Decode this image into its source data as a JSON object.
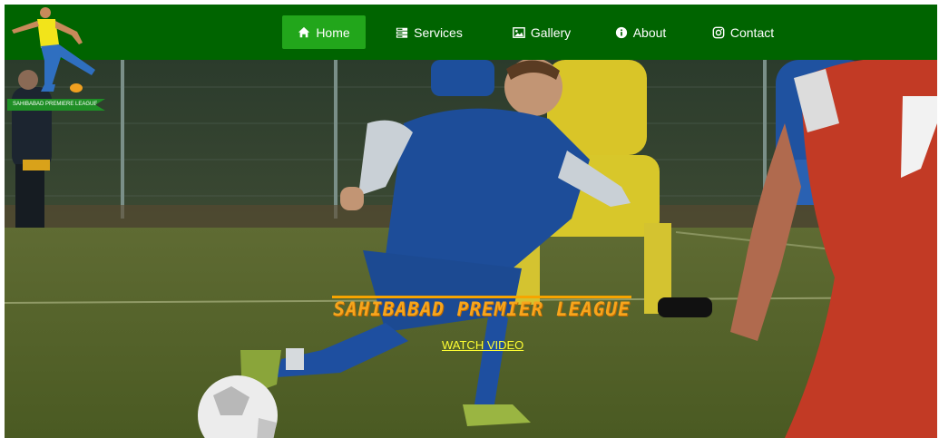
{
  "nav": {
    "items": [
      {
        "label": "Home",
        "icon": "home-icon",
        "active": true
      },
      {
        "label": "Services",
        "icon": "server-icon",
        "active": false
      },
      {
        "label": "Gallery",
        "icon": "image-icon",
        "active": false
      },
      {
        "label": "About",
        "icon": "info-icon",
        "active": false
      },
      {
        "label": "Contact",
        "icon": "instagram-icon",
        "active": false
      }
    ]
  },
  "logo": {
    "banner_text": "SAHIBABAD PREMIERE LEAGUE"
  },
  "hero": {
    "title": "SAHIBABAD PREMIER LEAGUE",
    "cta_label": "WATCH VIDEO"
  },
  "colors": {
    "navbar": "#006400",
    "active_tab": "#22a61b",
    "title": "#f7a51c",
    "cta": "#ffff33"
  }
}
